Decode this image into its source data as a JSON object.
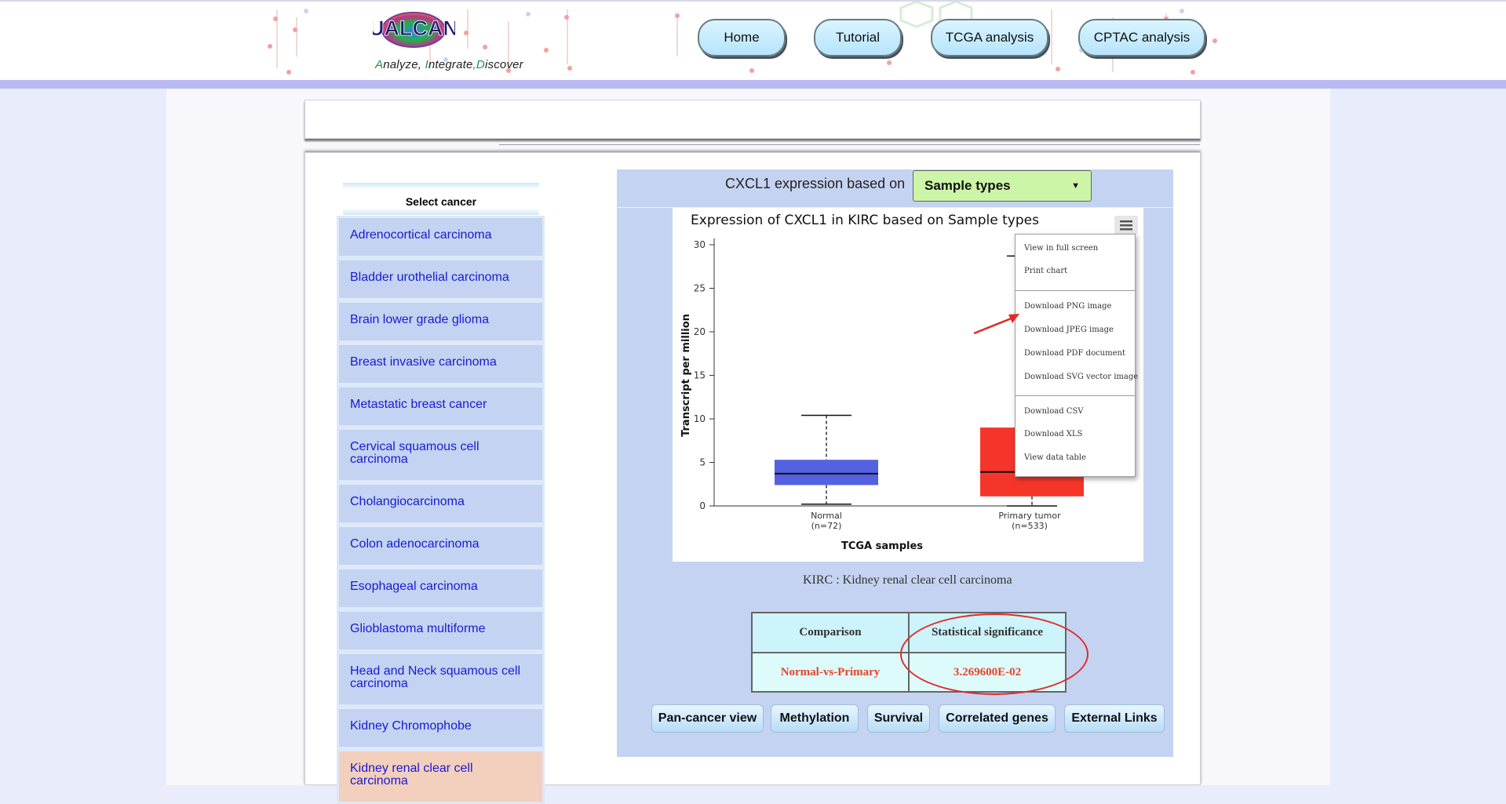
{
  "brand": {
    "name": "UALCAN",
    "tagline_parts": [
      "A",
      "nalyze, ",
      "I",
      "ntegrate",
      ",",
      "D",
      "iscover"
    ]
  },
  "nav": {
    "home": "Home",
    "tutorial": "Tutorial",
    "tcga": "TCGA analysis",
    "cptac": "CPTAC analysis"
  },
  "sidebar": {
    "header": "Select cancer",
    "items": [
      "Adrenocortical carcinoma",
      "Bladder urothelial carcinoma",
      "Brain lower grade glioma",
      "Breast invasive carcinoma",
      "Metastatic breast cancer",
      "Cervical squamous cell carcinoma",
      "Cholangiocarcinoma",
      "Colon adenocarcinoma",
      "Esophageal carcinoma",
      "Glioblastoma multiforme",
      "Head and Neck squamous cell carcinoma",
      "Kidney Chromophobe",
      "Kidney renal clear cell carcinoma"
    ],
    "active_item": "Kidney renal clear cell carcinoma"
  },
  "expression": {
    "label": "CXCL1 expression based on",
    "selected": "Sample types"
  },
  "chart_menu": {
    "items": [
      "View in full screen",
      "Print chart",
      "Download PNG image",
      "Download JPEG image",
      "Download PDF document",
      "Download SVG vector image",
      "Download CSV",
      "Download XLS",
      "View data table"
    ]
  },
  "chart_data": {
    "type": "boxplot",
    "title": "Expression of CXCL1 in KIRC based on Sample types",
    "xlabel": "TCGA samples",
    "ylabel": "Transcript per million",
    "ylim": [
      0,
      30
    ],
    "yticks": [
      0,
      5,
      10,
      15,
      20,
      25,
      30
    ],
    "categories": [
      "Normal",
      "Primary tumor"
    ],
    "category_counts": [
      "(n=72)",
      "(n=533)"
    ],
    "colors": [
      "#5461e0",
      "#f6352a"
    ],
    "series": [
      {
        "name": "Normal",
        "whisker_low": 0.2,
        "q1": 2.4,
        "median": 3.7,
        "q3": 5.3,
        "whisker_high": 10.4
      },
      {
        "name": "Primary tumor",
        "whisker_low": 0.0,
        "q1": 1.1,
        "median": 3.9,
        "q3": 9.0,
        "whisker_high": 28.7
      }
    ]
  },
  "caption": "KIRC : Kidney renal clear cell carcinoma",
  "comparison": {
    "headers": [
      "Comparison",
      "Statistical significance"
    ],
    "rows": [
      [
        "Normal-vs-Primary",
        "3.269600E-02"
      ]
    ]
  },
  "bottom_buttons": [
    "Pan-cancer view",
    "Methylation",
    "Survival",
    "Correlated genes",
    "External Links"
  ],
  "colors": {
    "accent_red": "#e8442b",
    "link_blue": "#1a1ad0",
    "panel_bg": "#c4d3f1",
    "select_green": "#ccf5a7"
  }
}
